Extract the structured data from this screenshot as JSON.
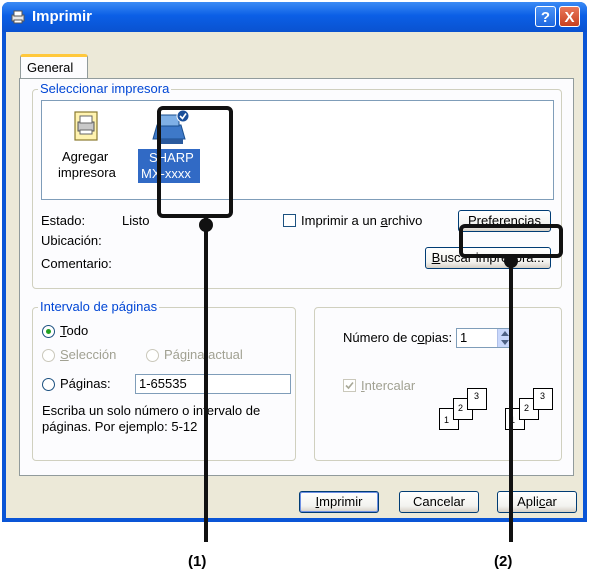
{
  "window": {
    "title": "Imprimir",
    "help_label": "?",
    "close_label": "X"
  },
  "tabs": [
    {
      "label": "General"
    }
  ],
  "printer_group": {
    "legend": "Seleccionar impresora",
    "printers": [
      {
        "name_line1": "Agregar",
        "name_line2": "impresora",
        "selected": false
      },
      {
        "name_line1": "SHARP",
        "name_line2": "MX-xxxx",
        "selected": true
      }
    ],
    "status_label": "Estado:",
    "status_value": "Listo",
    "location_label": "Ubicación:",
    "comment_label": "Comentario:",
    "print_to_file_pre": "Imprimir a un ",
    "print_to_file_key": "a",
    "print_to_file_post": "rchivo",
    "preferences_pre": "Pr",
    "preferences_key": "e",
    "preferences_post": "ferencias",
    "find_printer_key": "B",
    "find_printer_post": "uscar impresora..."
  },
  "range_group": {
    "legend": "Intervalo de páginas",
    "all_key": "T",
    "all_post": "odo",
    "selection_key": "S",
    "selection_post": "elección",
    "current_pre": "Pág",
    "current_key": "i",
    "current_post": "na actual",
    "pages_label": "Páginas:",
    "pages_value": "1-65535",
    "hint_line1": "Escriba un solo número o intervalo de",
    "hint_line2": "páginas. Por ejemplo: 5-12"
  },
  "copies_group": {
    "copies_pre": "Número de c",
    "copies_key": "o",
    "copies_post": "pias:",
    "copies_value": "1",
    "collate_key": "I",
    "collate_post": "ntercalar",
    "collate_checked": true
  },
  "collate_icon_numbers": [
    "1",
    "2",
    "3",
    "1",
    "2",
    "3"
  ],
  "footer": {
    "print_key": "I",
    "print_post": "mprimir",
    "cancel": "Cancelar",
    "apply_pre": "Apli",
    "apply_key": "c",
    "apply_post": "ar"
  },
  "callouts": [
    {
      "label": "(1)"
    },
    {
      "label": "(2)"
    }
  ],
  "colors": {
    "titlebar": "#0a55d6",
    "legend_text": "#0046d5",
    "dialog_bg": "#ece9d8",
    "selection": "#316ac5"
  }
}
